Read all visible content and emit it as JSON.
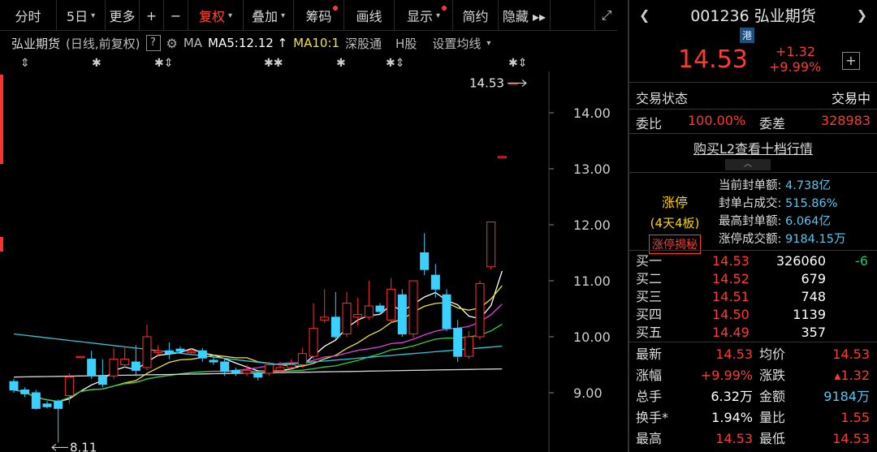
{
  "toolbar": {
    "items": [
      {
        "label": "分时",
        "dropdown": false,
        "dot": false,
        "active": false,
        "w": 70
      },
      {
        "label": "5日",
        "dropdown": true,
        "dot": false,
        "active": false,
        "w": 60
      },
      {
        "label": "更多",
        "dropdown": false,
        "dot": false,
        "active": false,
        "w": 42
      },
      {
        "label": "+",
        "dropdown": false,
        "dot": false,
        "active": false,
        "w": 30
      },
      {
        "label": "−",
        "dropdown": false,
        "dot": false,
        "active": false,
        "w": 30
      },
      {
        "label": "复权",
        "dropdown": true,
        "dot": false,
        "active": true,
        "w": 68
      },
      {
        "label": "叠加",
        "dropdown": true,
        "dot": false,
        "active": false,
        "w": 62
      },
      {
        "label": "筹码",
        "dropdown": false,
        "dot": true,
        "active": false,
        "w": 62
      },
      {
        "label": "画线",
        "dropdown": false,
        "dot": false,
        "active": false,
        "w": 62
      },
      {
        "label": "显示",
        "dropdown": true,
        "dot": true,
        "active": false,
        "w": 72
      },
      {
        "label": "简约",
        "dropdown": false,
        "dot": false,
        "active": false,
        "w": 56
      },
      {
        "label": "隐藏 ▸▸",
        "dropdown": false,
        "dot": false,
        "active": false,
        "w": 64
      }
    ],
    "fullscreen_icon": "expand-icon"
  },
  "infoline": {
    "name": "弘业期货",
    "mode": "(日线,前复权)",
    "help": "?",
    "ma_label": "MA",
    "ma5": "MA5:12.12 ↑",
    "ma10": "MA10:1",
    "sgt": "深股通",
    "hshare": "H股",
    "settings": "设置均线"
  },
  "chart_data": {
    "type": "candlestick",
    "yticks": [
      "14.00",
      "13.00",
      "12.00",
      "11.00",
      "10.00",
      "9.00"
    ],
    "ylim": [
      8.0,
      14.9
    ],
    "last_price_label": "14.53",
    "low_label": "8.11",
    "candles": [
      [
        9.2,
        9.05,
        9.25,
        9.0
      ],
      [
        9.05,
        8.98,
        9.1,
        8.92
      ],
      [
        9.0,
        8.72,
        9.05,
        8.7
      ],
      [
        8.8,
        8.75,
        8.85,
        8.72
      ],
      [
        8.85,
        8.72,
        8.88,
        8.11
      ],
      [
        8.95,
        9.28,
        9.35,
        8.8
      ],
      [
        9.65,
        9.65,
        9.66,
        9.64
      ],
      [
        9.6,
        9.3,
        9.75,
        9.25
      ],
      [
        9.3,
        9.15,
        9.6,
        9.1
      ],
      [
        9.3,
        9.6,
        9.8,
        9.25
      ],
      [
        9.5,
        9.6,
        9.82,
        9.45
      ],
      [
        9.55,
        9.4,
        9.85,
        9.3
      ],
      [
        9.45,
        10.0,
        10.22,
        9.4
      ],
      [
        9.72,
        9.75,
        9.85,
        9.65
      ],
      [
        9.75,
        9.7,
        9.9,
        9.6
      ],
      [
        9.78,
        9.74,
        9.83,
        9.7
      ],
      [
        9.72,
        9.75,
        9.8,
        9.7
      ],
      [
        9.75,
        9.62,
        9.8,
        9.55
      ],
      [
        9.58,
        9.55,
        9.65,
        9.5
      ],
      [
        9.55,
        9.38,
        9.6,
        9.3
      ],
      [
        9.4,
        9.35,
        9.45,
        9.3
      ],
      [
        9.35,
        9.4,
        9.5,
        9.3
      ],
      [
        9.35,
        9.28,
        9.38,
        9.22
      ],
      [
        9.35,
        9.5,
        9.55,
        9.3
      ],
      [
        9.4,
        9.45,
        9.55,
        9.35
      ],
      [
        9.45,
        9.5,
        9.6,
        9.4
      ],
      [
        9.5,
        9.7,
        9.8,
        9.45
      ],
      [
        9.65,
        10.15,
        10.6,
        9.6
      ],
      [
        10.3,
        10.35,
        10.85,
        10.25
      ],
      [
        10.35,
        10.0,
        10.8,
        9.95
      ],
      [
        10.05,
        10.6,
        10.8,
        10.0
      ],
      [
        10.35,
        10.4,
        10.7,
        10.2
      ],
      [
        10.35,
        10.55,
        11.0,
        10.3
      ],
      [
        10.55,
        10.45,
        10.6,
        10.4
      ],
      [
        10.3,
        10.85,
        11.05,
        10.25
      ],
      [
        10.75,
        10.05,
        10.85,
        10.0
      ],
      [
        10.05,
        11.0,
        11.0,
        9.98
      ],
      [
        11.5,
        11.2,
        11.85,
        11.1
      ],
      [
        11.1,
        10.85,
        11.3,
        10.7
      ],
      [
        10.75,
        10.15,
        10.85,
        10.1
      ],
      [
        10.15,
        9.65,
        10.3,
        9.55
      ],
      [
        9.65,
        10.0,
        10.1,
        9.6
      ],
      [
        10.0,
        10.95,
        11.0,
        9.95
      ],
      [
        11.25,
        12.05,
        12.05,
        11.2
      ],
      [
        13.22,
        13.22,
        13.23,
        13.21
      ],
      [
        14.53,
        14.53,
        14.54,
        14.52
      ]
    ],
    "ma_lines": [
      {
        "color": "#ffffff"
      },
      {
        "color": "#f0e040"
      },
      {
        "color": "#e040e0"
      },
      {
        "color": "#30d040"
      },
      {
        "color": "#30c8d8"
      },
      {
        "color": "#d8d8d8"
      }
    ]
  },
  "panel": {
    "code": "001236",
    "name": "弘业期货",
    "hk_badge": "港",
    "price": "14.53",
    "change": "+1.32",
    "change_pct": "+9.99%",
    "plus": "+",
    "trade_status_label": "交易状态",
    "trade_status": "交易中",
    "weibi_label": "委比",
    "weibi": "100.00%",
    "weicha_label": "委差",
    "weicha": "328983",
    "l2_link": "购买L2查看十档行情",
    "limit": {
      "title": "涨停",
      "boards": "(4天4板)",
      "reveal": "涨停揭秘",
      "info": [
        {
          "k": "当前封单额:",
          "v": "4.738亿"
        },
        {
          "k": "封单占成交:",
          "v": "515.86%"
        },
        {
          "k": "最高封单额:",
          "v": "6.064亿"
        },
        {
          "k": "涨停成交额:",
          "v": "9184.15万"
        }
      ]
    },
    "bids": [
      {
        "name": "买一",
        "price": "14.53",
        "vol": "326060",
        "delta": "-6"
      },
      {
        "name": "买二",
        "price": "14.52",
        "vol": "679",
        "delta": ""
      },
      {
        "name": "买三",
        "price": "14.51",
        "vol": "748",
        "delta": ""
      },
      {
        "name": "买四",
        "price": "14.50",
        "vol": "1139",
        "delta": ""
      },
      {
        "name": "买五",
        "price": "14.49",
        "vol": "357",
        "delta": ""
      }
    ],
    "stats": [
      {
        "k1": "最新",
        "v1": "14.53",
        "c1": "red",
        "k2": "均价",
        "v2": "14.53",
        "c2": "red"
      },
      {
        "k1": "涨幅",
        "v1": "+9.99%",
        "c1": "red",
        "k2": "涨跌",
        "v2": "▴1.32",
        "c2": "red"
      },
      {
        "k1": "总手",
        "v1": "6.32万",
        "c1": "white",
        "k2": "金额",
        "v2": "9184万",
        "c2": "cyan"
      },
      {
        "k1": "换手*",
        "v1": "1.94%",
        "c1": "white",
        "k2": "量比",
        "v2": "1.55",
        "c2": "red"
      },
      {
        "k1": "最高",
        "v1": "14.53",
        "c1": "red",
        "k2": "最低",
        "v2": "14.53",
        "c2": "red"
      }
    ]
  }
}
